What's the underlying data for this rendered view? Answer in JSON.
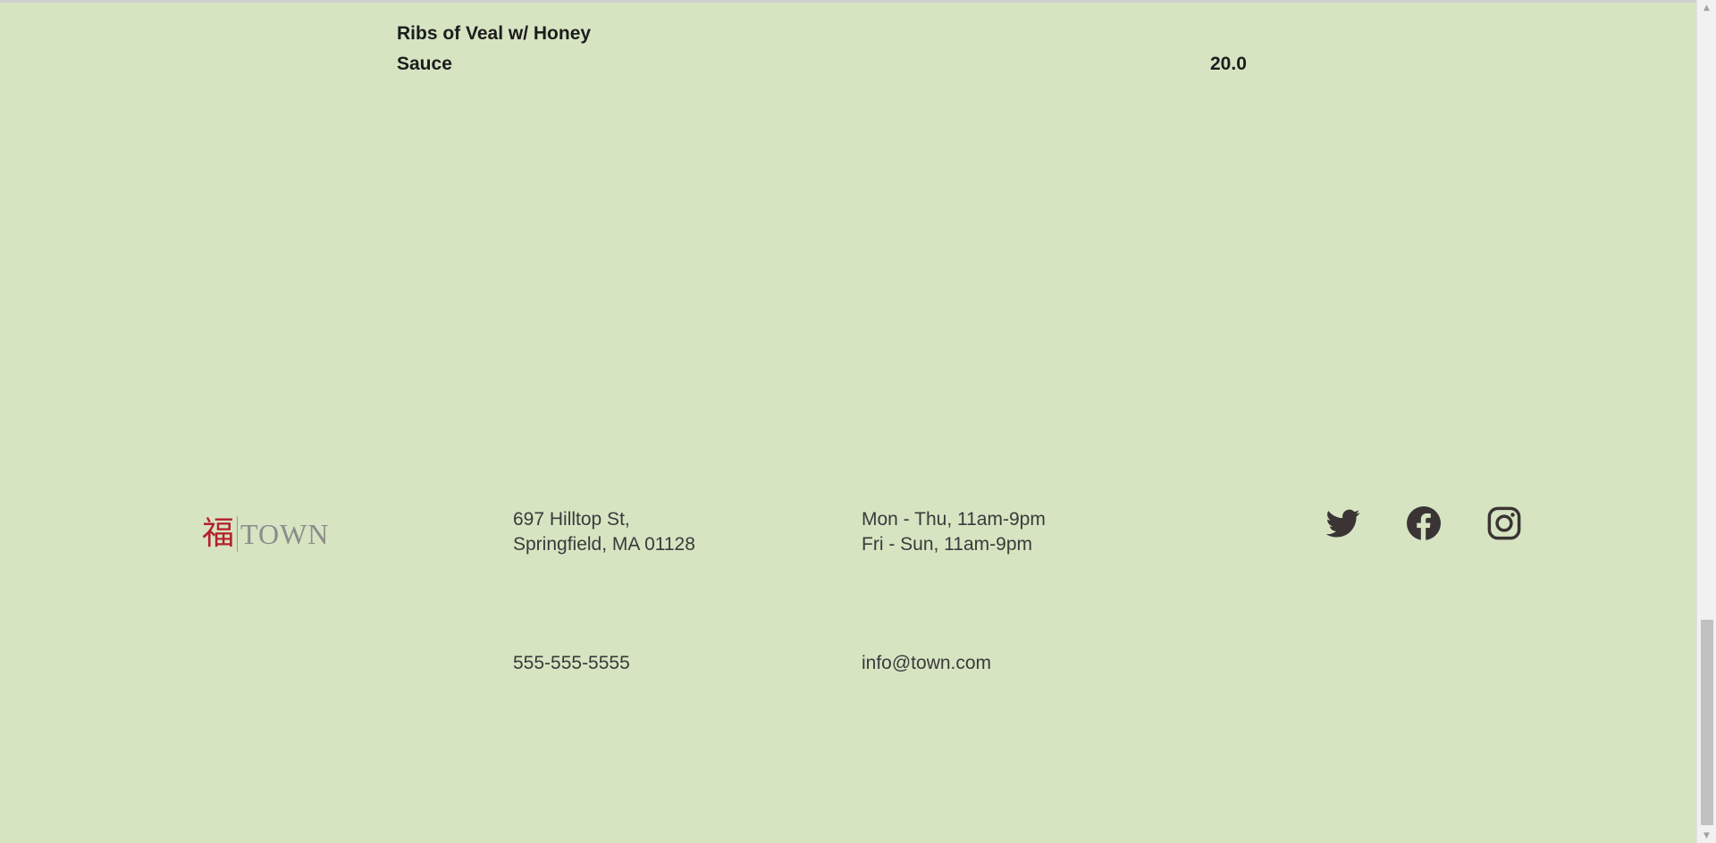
{
  "menu_item": {
    "name": "Ribs of Veal w/ Honey Sauce",
    "price": "20.0"
  },
  "footer": {
    "logo": {
      "char": "福",
      "text": "TOWN"
    },
    "address_line1": "697 Hilltop St,",
    "address_line2": "Springfield, MA 01128",
    "hours_line1": "Mon - Thu, 11am-9pm",
    "hours_line2": "Fri - Sun, 11am-9pm",
    "phone": "555-555-5555",
    "email": "info@town.com",
    "social": [
      {
        "name": "twitter-icon"
      },
      {
        "name": "facebook-icon"
      },
      {
        "name": "instagram-icon"
      }
    ]
  },
  "colors": {
    "background": "#d6e4c2",
    "logo_red": "#b51f2a",
    "logo_gray": "#8c8c8c",
    "icon": "#3a3434"
  },
  "scrollbar": {
    "position_fraction": 1.0
  }
}
